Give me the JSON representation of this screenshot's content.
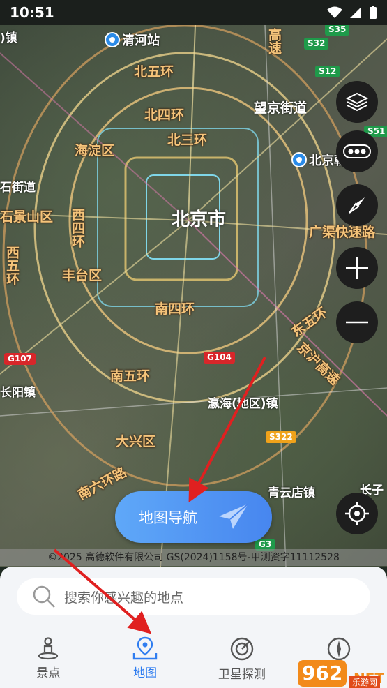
{
  "status_bar": {
    "time": "10:51"
  },
  "map": {
    "labels": {
      "qinghe": "清河站",
      "bei_wu_huan": "北五环",
      "bei_si_huan": "北四环",
      "bei_san_huan": "北三环",
      "haidian": "海淀区",
      "beijing": "北京市",
      "shijingshan": "石景山区",
      "xi_si_huan": "西四环",
      "fengtai": "丰台区",
      "xi_wu_huan": "西五环",
      "nan_si_huan": "南四环",
      "nan_wu_huan": "南五环",
      "daxing": "大兴区",
      "nan_liu_huan": "南六环路",
      "gaosu": "高速",
      "wangjing": "望京街道",
      "beijing_chaoyang": "北京朝阳站",
      "guangqu": "广渠快速路",
      "dong_wu_huan": "东五环",
      "jinghu": "京沪高速",
      "yinghai": "瀛海(地区)镇",
      "qingyundian": "青云店镇",
      "changyang": "长阳镇",
      "jiedao_left": "石街道",
      "zhen_top": ")镇",
      "changzi": "长子"
    },
    "shields": {
      "s35": "S35",
      "s32": "S32",
      "s12": "S12",
      "s51": "S51",
      "g107": "G107",
      "g104": "G104",
      "s322": "S322",
      "g3": "G3"
    },
    "copyright": "©2025 高德软件有限公司 GS(2024)1158号-甲测资字11112528"
  },
  "controls": {
    "layers": "layers-icon",
    "traffic": "traffic-icon",
    "compass": "compass-icon",
    "zoom_in": "+",
    "zoom_out": "−",
    "locate": "locate-icon"
  },
  "nav_button": {
    "label": "地图导航"
  },
  "search": {
    "placeholder": "搜索你感兴趣的地点"
  },
  "tabs": [
    {
      "label": "景点",
      "icon": "person-pin-icon"
    },
    {
      "label": "地图",
      "icon": "map-pin-icon",
      "active": true
    },
    {
      "label": "卫星探测",
      "icon": "satellite-icon"
    },
    {
      "label": "",
      "icon": "compass-icon"
    }
  ],
  "watermark": {
    "number": "962",
    "suffix": ".NET",
    "sub": "乐游网"
  },
  "colors": {
    "accent": "#2f7df0",
    "label_orange": "#f5c47a",
    "arrow_red": "#e02020"
  }
}
